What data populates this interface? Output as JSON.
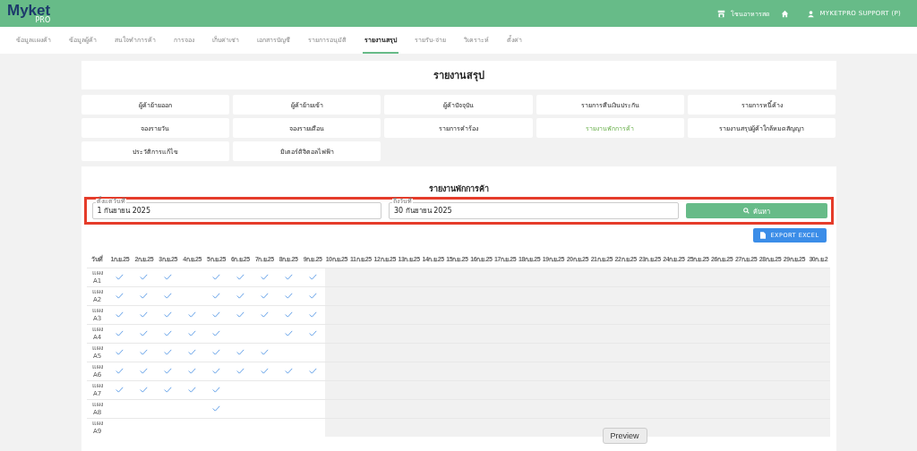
{
  "header": {
    "logo": "Myket",
    "logo_sub": "PRO",
    "shop": "โซนอาหารสด",
    "user": "MYKETPRO SUPPORT (P)"
  },
  "nav": [
    {
      "label": "ข้อมูลแผงค้า",
      "selected": false
    },
    {
      "label": "ข้อมูลผู้ค้า",
      "selected": false
    },
    {
      "label": "สนใจทำการค้า",
      "selected": false
    },
    {
      "label": "การจอง",
      "selected": false
    },
    {
      "label": "เก็บค่าเช่า",
      "selected": false
    },
    {
      "label": "เอกสารบัญชี",
      "selected": false
    },
    {
      "label": "รายการอนุมัติ",
      "selected": false
    },
    {
      "label": "รายงานสรุป",
      "selected": true
    },
    {
      "label": "รายรับ-จ่าย",
      "selected": false
    },
    {
      "label": "วิเคราะห์",
      "selected": false
    },
    {
      "label": "ตั้งค่า",
      "selected": false
    }
  ],
  "page_title": "รายงานสรุป",
  "reports": [
    {
      "label": "ผู้ค้าย้ายออก",
      "selected": false
    },
    {
      "label": "ผู้ค้าย้ายเข้า",
      "selected": false
    },
    {
      "label": "ผู้ค้าปัจจุบัน",
      "selected": false
    },
    {
      "label": "รายการคืนเงินประกัน",
      "selected": false
    },
    {
      "label": "รายการหนี้ค้าง",
      "selected": false
    },
    {
      "label": "จองรายวัน",
      "selected": false
    },
    {
      "label": "จองรายเดือน",
      "selected": false
    },
    {
      "label": "รายการคำร้อง",
      "selected": false
    },
    {
      "label": "รายงานพักการค้า",
      "selected": true
    },
    {
      "label": "รายงานสรุปผู้ค้าใกล้หมดสัญญา",
      "selected": false
    },
    {
      "label": "ประวัติการแก้ไข",
      "selected": false
    },
    {
      "label": "มิเตอร์ดิจิตอลไฟฟ้า",
      "selected": false
    }
  ],
  "report": {
    "title": "รายงานพักการค้า",
    "from": {
      "label": "ตั้งแต่วันที่",
      "value": "1 กันยายน 2025"
    },
    "to": {
      "label": "ถึงวันที่",
      "value": "30 กันยายน 2025"
    },
    "search_button": "ค้นหา",
    "export_button": "EXPORT EXCEL"
  },
  "table": {
    "first_column": "วันที่",
    "days": [
      {
        "label": "1ก.ย.25",
        "past": true
      },
      {
        "label": "2ก.ย.25",
        "past": true
      },
      {
        "label": "3ก.ย.25",
        "past": true
      },
      {
        "label": "4ก.ย.25",
        "past": true
      },
      {
        "label": "5ก.ย.25",
        "past": true
      },
      {
        "label": "6ก.ย.25",
        "past": true
      },
      {
        "label": "7ก.ย.25",
        "past": true
      },
      {
        "label": "8ก.ย.25",
        "past": true
      },
      {
        "label": "9ก.ย.25",
        "past": true
      },
      {
        "label": "10ก.ย.25",
        "past": false
      },
      {
        "label": "11ก.ย.25",
        "past": false
      },
      {
        "label": "12ก.ย.25",
        "past": false
      },
      {
        "label": "13ก.ย.25",
        "past": false
      },
      {
        "label": "14ก.ย.25",
        "past": false
      },
      {
        "label": "15ก.ย.25",
        "past": false
      },
      {
        "label": "16ก.ย.25",
        "past": false
      },
      {
        "label": "17ก.ย.25",
        "past": false
      },
      {
        "label": "18ก.ย.25",
        "past": false
      },
      {
        "label": "19ก.ย.25",
        "past": false
      },
      {
        "label": "20ก.ย.25",
        "past": false
      },
      {
        "label": "21ก.ย.25",
        "past": false
      },
      {
        "label": "22ก.ย.25",
        "past": false
      },
      {
        "label": "23ก.ย.25",
        "past": false
      },
      {
        "label": "24ก.ย.25",
        "past": false
      },
      {
        "label": "25ก.ย.25",
        "past": false
      },
      {
        "label": "26ก.ย.25",
        "past": false
      },
      {
        "label": "27ก.ย.25",
        "past": false
      },
      {
        "label": "28ก.ย.25",
        "past": false
      },
      {
        "label": "29ก.ย.25",
        "past": false
      },
      {
        "label": "30ก.ย.2",
        "past": false
      }
    ],
    "rows": [
      {
        "stall": "แผง A1",
        "checks": [
          true,
          true,
          true,
          false,
          true,
          true,
          true,
          true,
          true
        ]
      },
      {
        "stall": "แผง A2",
        "checks": [
          true,
          true,
          true,
          false,
          true,
          true,
          true,
          true,
          true
        ]
      },
      {
        "stall": "แผง A3",
        "checks": [
          true,
          true,
          true,
          true,
          true,
          true,
          true,
          true,
          true
        ]
      },
      {
        "stall": "แผง A4",
        "checks": [
          true,
          true,
          true,
          true,
          true,
          false,
          false,
          true,
          true
        ]
      },
      {
        "stall": "แผง A5",
        "checks": [
          true,
          true,
          true,
          true,
          true,
          true,
          true,
          false,
          false
        ]
      },
      {
        "stall": "แผง A6",
        "checks": [
          true,
          true,
          true,
          true,
          true,
          true,
          true,
          true,
          true
        ]
      },
      {
        "stall": "แผง A7",
        "checks": [
          true,
          true,
          true,
          true,
          true,
          false,
          false,
          false,
          false
        ]
      },
      {
        "stall": "แผง A8",
        "checks": [
          false,
          false,
          false,
          false,
          true,
          false,
          false,
          false,
          false
        ]
      },
      {
        "stall": "แผง A9",
        "checks": [
          false,
          false,
          false,
          false,
          false,
          false,
          false,
          false,
          false
        ]
      }
    ]
  },
  "tooltip": "Preview"
}
